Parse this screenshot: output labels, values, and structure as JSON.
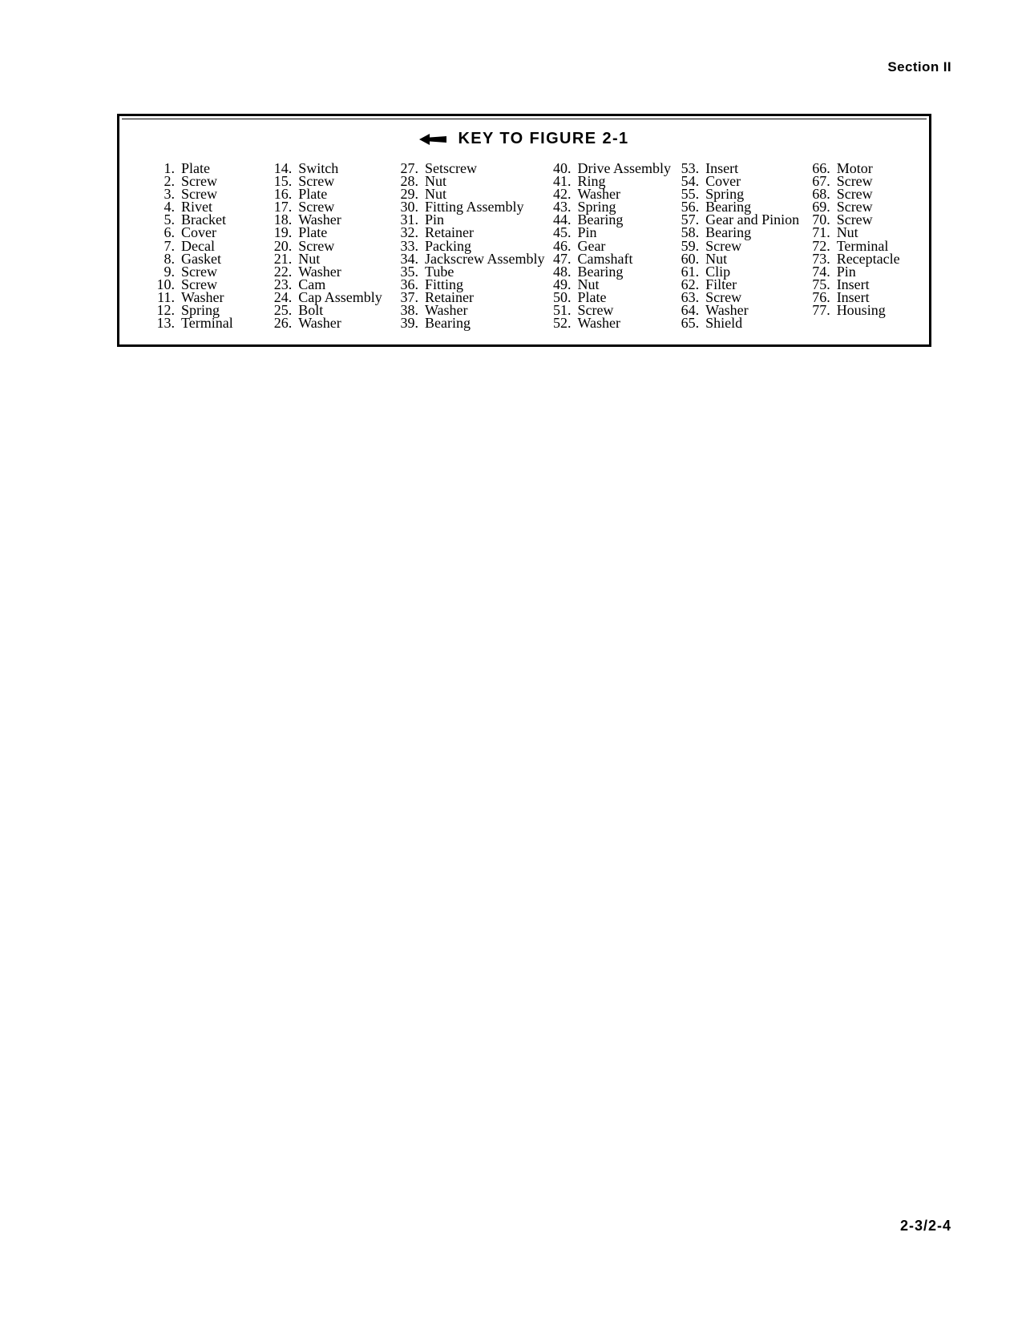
{
  "header": {
    "section_label": "Section II"
  },
  "footer": {
    "page_number": "2-3/2-4"
  },
  "key_box": {
    "arrow_icon": "left-arrow-icon",
    "title": "KEY  TO  FIGURE  2-1",
    "columns": [
      {
        "id": "column-1",
        "entries": [
          {
            "num": "1.",
            "name": "Plate"
          },
          {
            "num": "2.",
            "name": "Screw"
          },
          {
            "num": "3.",
            "name": "Screw"
          },
          {
            "num": "4.",
            "name": "Rivet"
          },
          {
            "num": "5.",
            "name": "Bracket"
          },
          {
            "num": "6.",
            "name": "Cover"
          },
          {
            "num": "7.",
            "name": "Decal"
          },
          {
            "num": "8.",
            "name": "Gasket"
          },
          {
            "num": "9.",
            "name": "Screw"
          },
          {
            "num": "10.",
            "name": "Screw"
          },
          {
            "num": "11.",
            "name": "Washer"
          },
          {
            "num": "12.",
            "name": "Spring"
          },
          {
            "num": "13.",
            "name": "Terminal"
          }
        ]
      },
      {
        "id": "column-2",
        "entries": [
          {
            "num": "14.",
            "name": "Switch"
          },
          {
            "num": "15.",
            "name": "Screw"
          },
          {
            "num": "16.",
            "name": "Plate"
          },
          {
            "num": "17.",
            "name": "Screw"
          },
          {
            "num": "18.",
            "name": "Washer"
          },
          {
            "num": "19.",
            "name": "Plate"
          },
          {
            "num": "20.",
            "name": "Screw"
          },
          {
            "num": "21.",
            "name": "Nut"
          },
          {
            "num": "22.",
            "name": "Washer"
          },
          {
            "num": "23.",
            "name": "Cam"
          },
          {
            "num": "24.",
            "name": "Cap Assembly"
          },
          {
            "num": "25.",
            "name": "Bolt"
          },
          {
            "num": "26.",
            "name": "Washer"
          }
        ]
      },
      {
        "id": "column-3",
        "entries": [
          {
            "num": "27.",
            "name": "Setscrew"
          },
          {
            "num": "28.",
            "name": "Nut"
          },
          {
            "num": "29.",
            "name": "Nut"
          },
          {
            "num": "30.",
            "name": "Fitting Assembly"
          },
          {
            "num": "31.",
            "name": "Pin"
          },
          {
            "num": "32.",
            "name": "Retainer"
          },
          {
            "num": "33.",
            "name": "Packing"
          },
          {
            "num": "34.",
            "name": "Jackscrew Assembly"
          },
          {
            "num": "35.",
            "name": "Tube"
          },
          {
            "num": "36.",
            "name": "Fitting"
          },
          {
            "num": "37.",
            "name": "Retainer"
          },
          {
            "num": "38.",
            "name": "Washer"
          },
          {
            "num": "39.",
            "name": "Bearing"
          }
        ]
      },
      {
        "id": "column-4",
        "entries": [
          {
            "num": "40.",
            "name": "Drive Assembly"
          },
          {
            "num": "41.",
            "name": "Ring"
          },
          {
            "num": "42.",
            "name": "Washer"
          },
          {
            "num": "43.",
            "name": "Spring"
          },
          {
            "num": "44.",
            "name": "Bearing"
          },
          {
            "num": "45.",
            "name": "Pin"
          },
          {
            "num": "46.",
            "name": "Gear"
          },
          {
            "num": "47.",
            "name": "Camshaft"
          },
          {
            "num": "48.",
            "name": "Bearing"
          },
          {
            "num": "49.",
            "name": "Nut"
          },
          {
            "num": "50.",
            "name": "Plate"
          },
          {
            "num": "51.",
            "name": "Screw"
          },
          {
            "num": "52.",
            "name": "Washer"
          }
        ]
      },
      {
        "id": "column-5",
        "entries": [
          {
            "num": "53.",
            "name": "Insert"
          },
          {
            "num": "54.",
            "name": "Cover"
          },
          {
            "num": "55.",
            "name": "Spring"
          },
          {
            "num": "56.",
            "name": "Bearing"
          },
          {
            "num": "57.",
            "name": "Gear and Pinion"
          },
          {
            "num": "58.",
            "name": "Bearing"
          },
          {
            "num": "59.",
            "name": "Screw"
          },
          {
            "num": "60.",
            "name": "Nut"
          },
          {
            "num": "61.",
            "name": "Clip"
          },
          {
            "num": "62.",
            "name": "Filter"
          },
          {
            "num": "63.",
            "name": "Screw"
          },
          {
            "num": "64.",
            "name": "Washer"
          },
          {
            "num": "65.",
            "name": "Shield"
          }
        ]
      },
      {
        "id": "column-6",
        "entries": [
          {
            "num": "66.",
            "name": "Motor"
          },
          {
            "num": "67.",
            "name": "Screw"
          },
          {
            "num": "68.",
            "name": "Screw"
          },
          {
            "num": "69.",
            "name": "Screw"
          },
          {
            "num": "70.",
            "name": "Screw"
          },
          {
            "num": "71.",
            "name": "Nut"
          },
          {
            "num": "72.",
            "name": "Terminal"
          },
          {
            "num": "73.",
            "name": "Receptacle"
          },
          {
            "num": "74.",
            "name": "Pin"
          },
          {
            "num": "75.",
            "name": "Insert"
          },
          {
            "num": "76.",
            "name": "Insert"
          },
          {
            "num": "77.",
            "name": "Housing"
          }
        ]
      }
    ]
  }
}
